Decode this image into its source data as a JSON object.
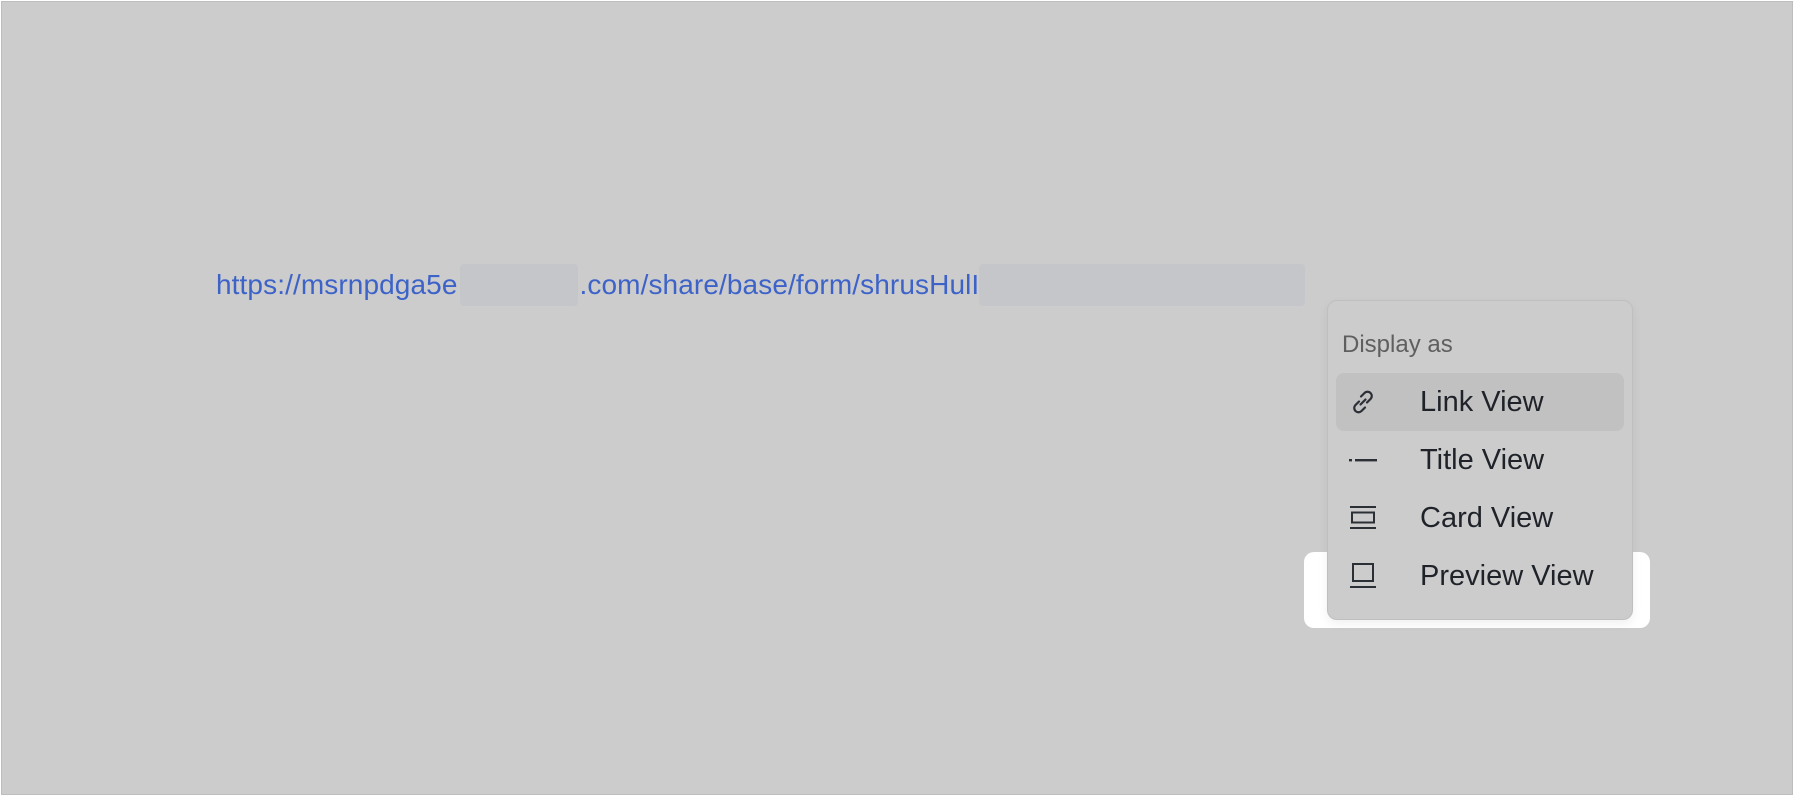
{
  "link": {
    "prefix": "https://msrnpdga5e",
    "middle": ".com/share/base/form/shrusHulI"
  },
  "menu": {
    "header": "Display as",
    "items": [
      {
        "label": "Link View",
        "icon": "link-icon",
        "selected": true
      },
      {
        "label": "Title View",
        "icon": "title-icon",
        "selected": false
      },
      {
        "label": "Card View",
        "icon": "card-icon",
        "selected": false
      },
      {
        "label": "Preview View",
        "icon": "preview-icon",
        "selected": false,
        "highlighted": true
      }
    ]
  },
  "colors": {
    "link": "#3d63c9",
    "background": "#cccccc",
    "active_item": "#c1c1c1",
    "highlight": "#ffffff"
  }
}
